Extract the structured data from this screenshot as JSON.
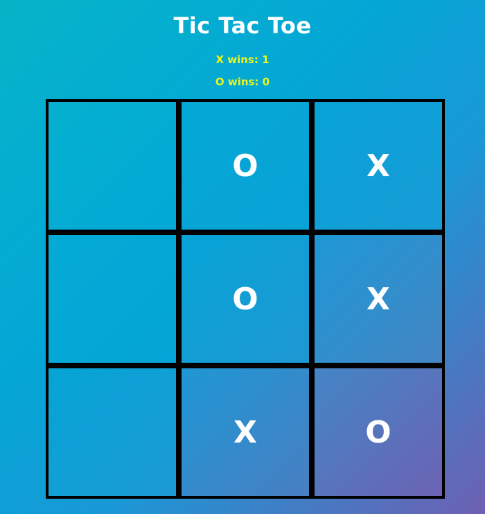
{
  "title": "Tic Tac Toe",
  "scores": {
    "x_wins": "X wins: 1",
    "o_wins": "O wins: 0"
  },
  "board": {
    "cells": [
      "",
      "O",
      "X",
      "",
      "O",
      "X",
      "",
      "X",
      "O"
    ]
  },
  "colors": {
    "title": "#ffffff",
    "score": "#eef518",
    "grid_lines": "#000000",
    "marks": "#ffffff"
  }
}
